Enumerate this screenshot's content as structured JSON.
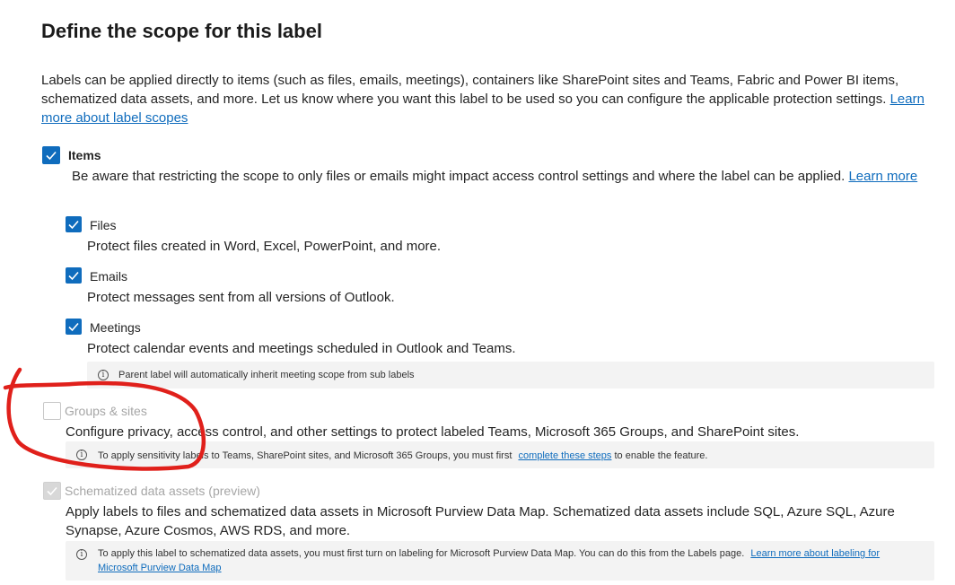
{
  "title": "Define the scope for this label",
  "intro": {
    "text": "Labels can be applied directly to items (such as files, emails, meetings), containers like SharePoint sites and Teams, Fabric and Power BI items, schematized data assets, and more. Let us know where you want this label to be used so you can configure the applicable protection settings.",
    "link": "Learn more about label scopes"
  },
  "items": {
    "label": "Items",
    "checked": true,
    "desc": "Be aware that restricting the scope to only files or emails might impact access control settings and where the label can be applied.",
    "desc_link": "Learn more",
    "children": [
      {
        "label": "Files",
        "checked": true,
        "desc": "Protect files created in Word, Excel, PowerPoint, and more."
      },
      {
        "label": "Emails",
        "checked": true,
        "desc": "Protect messages sent from all versions of Outlook."
      },
      {
        "label": "Meetings",
        "checked": true,
        "desc": "Protect calendar events and meetings scheduled in Outlook and Teams."
      }
    ],
    "meeting_info": "Parent label will automatically inherit meeting scope from sub labels"
  },
  "groups": {
    "label": "Groups & sites",
    "checked": false,
    "disabled": true,
    "desc": "Configure privacy, access control, and other settings to protect labeled Teams, Microsoft 365 Groups, and SharePoint sites.",
    "info_before": "To apply sensitivity labels to Teams, SharePoint sites, and Microsoft 365 Groups, you must first",
    "info_link": "complete these steps",
    "info_after": "to enable the feature."
  },
  "schematized": {
    "label": "Schematized data assets (preview)",
    "checked": true,
    "disabled": true,
    "desc": "Apply labels to files and schematized data assets in Microsoft Purview Data Map. Schematized data assets include SQL, Azure SQL, Azure Synapse, Azure Cosmos, AWS RDS, and more.",
    "info_text": "To apply this label to schematized data assets, you must first turn on labeling for Microsoft Purview Data Map. You can do this from the Labels page.",
    "info_link": "Learn more about labeling for Microsoft Purview Data Map"
  },
  "colors": {
    "accent": "#0f6cbd",
    "annotation": "#e0201b"
  }
}
